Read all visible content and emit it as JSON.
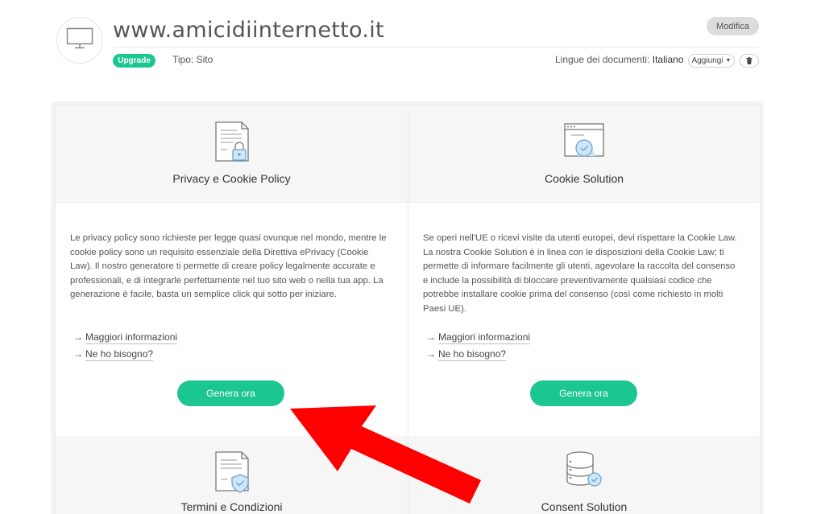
{
  "header": {
    "site_title": "www.amicidiinternetto.it",
    "modifica_label": "Modifica",
    "upgrade_label": "Upgrade",
    "tipo_label": "Tipo:",
    "tipo_value": "Sito",
    "lingue_label": "Lingue dei documenti:",
    "lingue_value": "Italiano",
    "aggiungi_label": "Aggiungi"
  },
  "cards": [
    {
      "title": "Privacy e Cookie Policy",
      "icon": "document-lock-icon",
      "description": "Le privacy policy sono richieste per legge quasi ovunque nel mondo, mentre le cookie policy sono un requisito essenziale della Direttiva ePrivacy (Cookie Law). Il nostro generatore ti permette di creare policy legalmente accurate e professionali, e di integrarle perfettamente nel tuo sito web o nella tua app. La generazione è facile, basta un semplice click qui sotto per iniziare.",
      "link_more": "Maggiori informazioni",
      "link_need": "Ne ho bisogno?",
      "button": "Genera ora"
    },
    {
      "title": "Cookie Solution",
      "icon": "browser-check-icon",
      "description": "Se operi nell'UE o ricevi visite da utenti europei, devi rispettare la Cookie Law. La nostra Cookie Solution è in linea con le disposizioni della Cookie Law; ti permette di informare facilmente gli utenti, agevolare la raccolta del consenso e include la possibilità di bloccare preventivamente qualsiasi codice che potrebbe installare cookie prima del consenso (così come richiesto in molti Paesi UE).",
      "link_more": "Maggiori informazioni",
      "link_need": "Ne ho bisogno?",
      "button": "Genera ora"
    },
    {
      "title": "Termini e Condizioni",
      "icon": "document-shield-icon"
    },
    {
      "title": "Consent Solution",
      "icon": "database-check-icon"
    }
  ],
  "colors": {
    "accent": "#1cc691",
    "arrow": "#ff0000"
  }
}
